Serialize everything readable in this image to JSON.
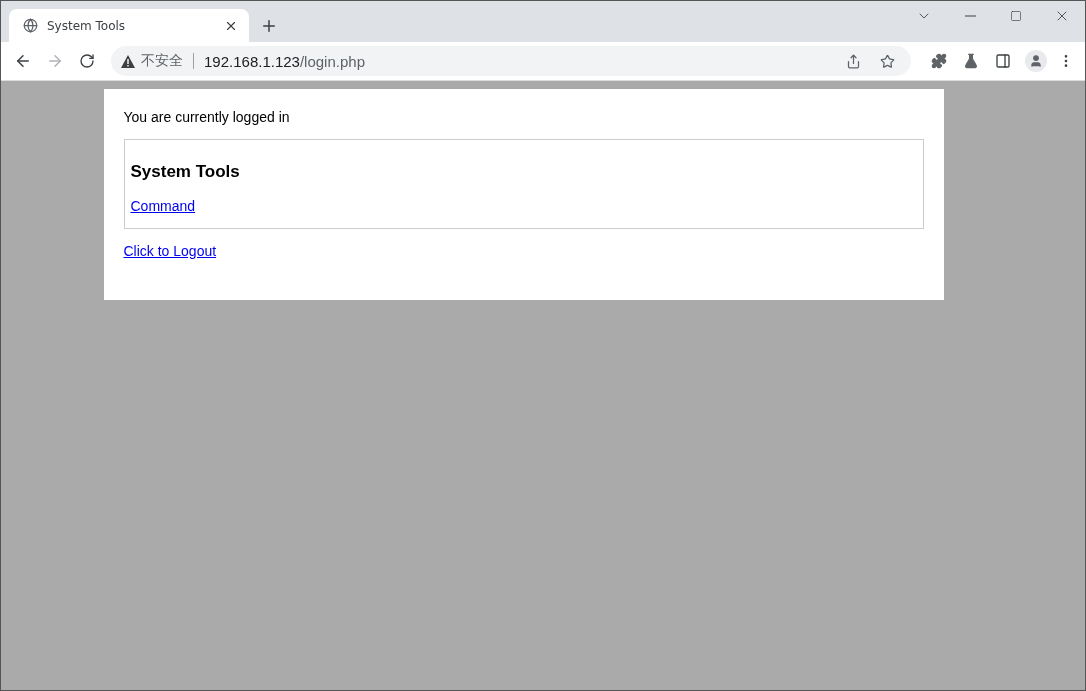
{
  "tabs": [
    {
      "title": "System Tools",
      "selected": true
    }
  ],
  "nav": {
    "back_disabled": false,
    "forward_disabled": true
  },
  "address_bar": {
    "security_label": "不安全",
    "url_host": "192.168.1.123",
    "url_path": "/login.php"
  },
  "page": {
    "status": "You are currently logged in",
    "panel": {
      "heading": "System Tools",
      "links": [
        "Command"
      ]
    },
    "logout_link": "Click to Logout"
  }
}
